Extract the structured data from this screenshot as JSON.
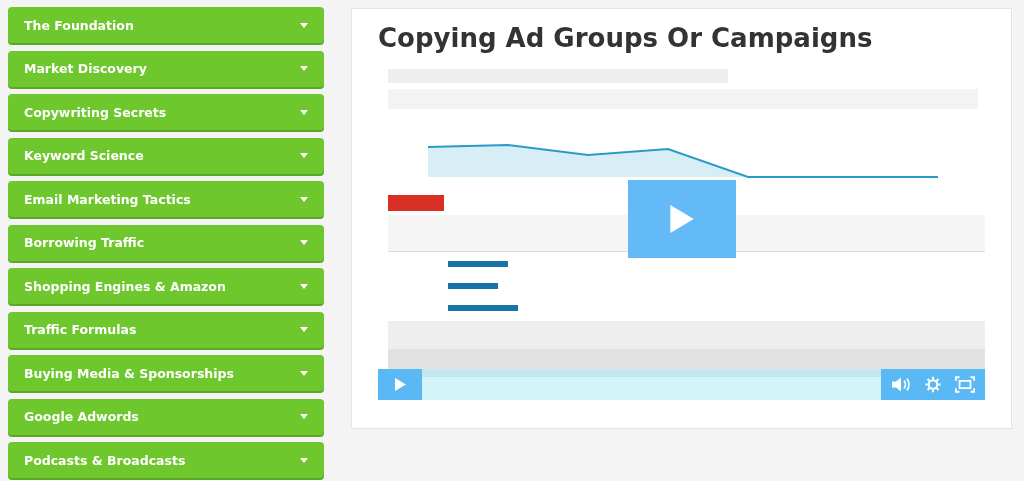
{
  "sidebar": {
    "items": [
      {
        "label": "The Foundation",
        "expanded": false
      },
      {
        "label": "Market Discovery",
        "expanded": false
      },
      {
        "label": "Copywriting Secrets",
        "expanded": false
      },
      {
        "label": "Keyword Science",
        "expanded": false
      },
      {
        "label": "Email Marketing Tactics",
        "expanded": false
      },
      {
        "label": "Borrowing Traffic",
        "expanded": false
      },
      {
        "label": "Shopping Engines & Amazon",
        "expanded": false
      },
      {
        "label": "Traffic Formulas",
        "expanded": false
      },
      {
        "label": "Buying Media & Sponsorships",
        "expanded": false
      },
      {
        "label": "Google Adwords",
        "expanded": false
      },
      {
        "label": "Podcasts & Broadcasts",
        "expanded": false
      }
    ]
  },
  "lesson": {
    "title": "Copying Ad Groups Or Campaigns",
    "video": {
      "kind": "picture",
      "playing": false,
      "progress": {
        "level": 0
      }
    }
  }
}
